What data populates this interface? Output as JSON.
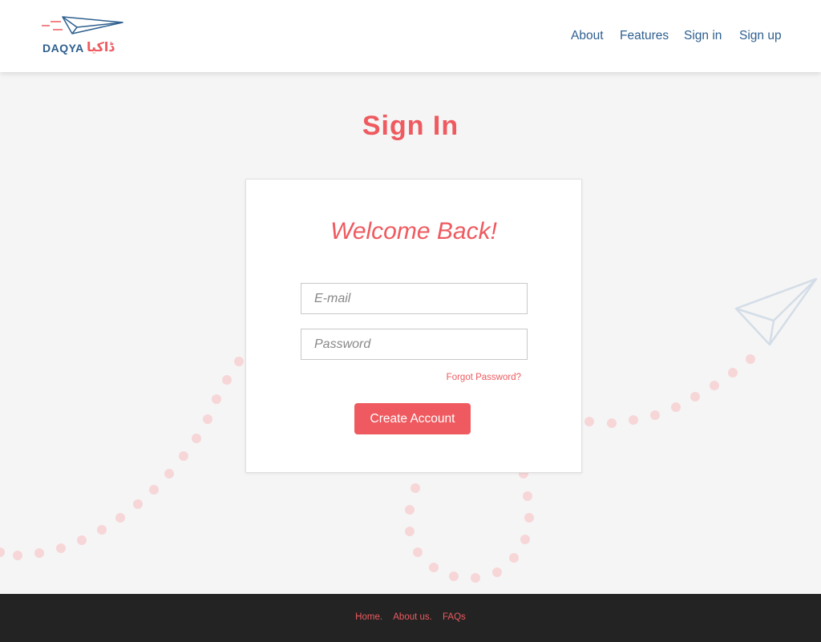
{
  "brand": {
    "name": "DAQYA",
    "urdu_name": "ڈاکیا",
    "primary_color": "#2e5f8f",
    "accent_color": "#ee5a5f"
  },
  "nav": {
    "about": "About",
    "features": "Features",
    "signin": "Sign in",
    "signup": "Sign up"
  },
  "page": {
    "title": "Sign In"
  },
  "form": {
    "welcome": "Welcome Back!",
    "email_placeholder": "E-mail",
    "password_placeholder": "Password",
    "forgot_label": "Forgot Password?",
    "submit_label": "Create Account"
  },
  "footer": {
    "links": [
      "Home.",
      "About us.",
      "FAQs"
    ]
  },
  "icons": [
    "paper-plane-logo-icon",
    "paper-plane-decoration-icon",
    "dotted-path-decoration"
  ]
}
